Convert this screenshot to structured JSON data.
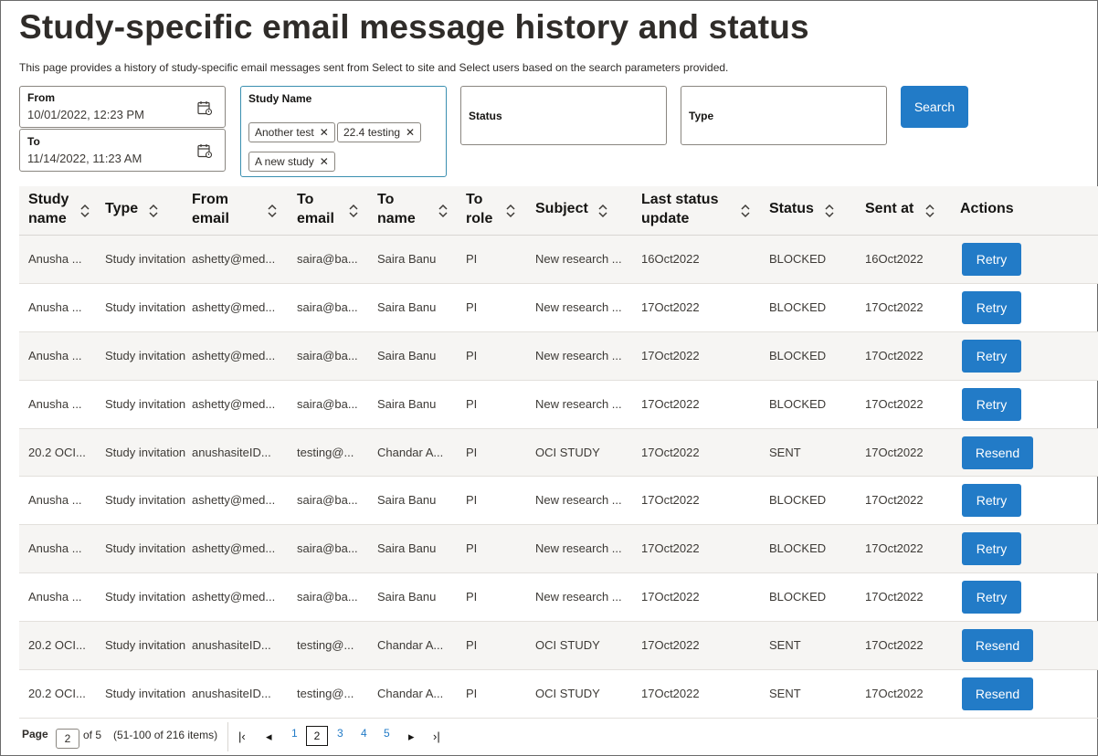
{
  "page": {
    "title": "Study-specific email message history and status",
    "description": "This page provides a history of study-specific email messages sent from Select to site and Select users based on the search parameters provided."
  },
  "filters": {
    "from": {
      "label": "From",
      "value": "10/01/2022, 12:23 PM"
    },
    "to": {
      "label": "To",
      "value": "11/14/2022, 11:23 AM"
    },
    "study_name": {
      "label": "Study Name",
      "chips": [
        "Another test",
        "22.4 testing",
        "A new study"
      ]
    },
    "status": {
      "label": "Status"
    },
    "type": {
      "label": "Type"
    },
    "search_label": "Search"
  },
  "table": {
    "columns": [
      {
        "l1": "Study",
        "l2": "name"
      },
      {
        "l1": "Type",
        "l2": ""
      },
      {
        "l1": "From",
        "l2": "email"
      },
      {
        "l1": "To",
        "l2": "email"
      },
      {
        "l1": "To",
        "l2": "name"
      },
      {
        "l1": "To",
        "l2": "role"
      },
      {
        "l1": "Subject",
        "l2": ""
      },
      {
        "l1": "Last status",
        "l2": "update"
      },
      {
        "l1": "Status",
        "l2": ""
      },
      {
        "l1": "Sent at",
        "l2": ""
      },
      {
        "l1": "Actions",
        "l2": ""
      }
    ],
    "rows": [
      {
        "study": "Anusha ...",
        "type": "Study invitation",
        "from": "ashetty@med...",
        "to_email": "saira@ba...",
        "to_name": "Saira Banu",
        "role": "PI",
        "subject": "New research ...",
        "last_update": "16Oct2022",
        "status": "BLOCKED",
        "sent_at": "16Oct2022",
        "action": "Retry"
      },
      {
        "study": "Anusha ...",
        "type": "Study invitation",
        "from": "ashetty@med...",
        "to_email": "saira@ba...",
        "to_name": "Saira Banu",
        "role": "PI",
        "subject": "New research ...",
        "last_update": "17Oct2022",
        "status": "BLOCKED",
        "sent_at": "17Oct2022",
        "action": "Retry"
      },
      {
        "study": "Anusha ...",
        "type": "Study invitation",
        "from": "ashetty@med...",
        "to_email": "saira@ba...",
        "to_name": "Saira Banu",
        "role": "PI",
        "subject": "New research ...",
        "last_update": "17Oct2022",
        "status": "BLOCKED",
        "sent_at": "17Oct2022",
        "action": "Retry"
      },
      {
        "study": "Anusha ...",
        "type": "Study invitation",
        "from": "ashetty@med...",
        "to_email": "saira@ba...",
        "to_name": "Saira Banu",
        "role": "PI",
        "subject": "New research ...",
        "last_update": "17Oct2022",
        "status": "BLOCKED",
        "sent_at": "17Oct2022",
        "action": "Retry"
      },
      {
        "study": "20.2 OCI...",
        "type": "Study invitation",
        "from": "anushasiteID...",
        "to_email": "testing@...",
        "to_name": "Chandar A...",
        "role": "PI",
        "subject": "OCI STUDY",
        "last_update": "17Oct2022",
        "status": "SENT",
        "sent_at": "17Oct2022",
        "action": "Resend"
      },
      {
        "study": "Anusha ...",
        "type": "Study invitation",
        "from": "ashetty@med...",
        "to_email": "saira@ba...",
        "to_name": "Saira Banu",
        "role": "PI",
        "subject": "New research ...",
        "last_update": "17Oct2022",
        "status": "BLOCKED",
        "sent_at": "17Oct2022",
        "action": "Retry"
      },
      {
        "study": "Anusha ...",
        "type": "Study invitation",
        "from": "ashetty@med...",
        "to_email": "saira@ba...",
        "to_name": "Saira Banu",
        "role": "PI",
        "subject": "New research ...",
        "last_update": "17Oct2022",
        "status": "BLOCKED",
        "sent_at": "17Oct2022",
        "action": "Retry"
      },
      {
        "study": "Anusha ...",
        "type": "Study invitation",
        "from": "ashetty@med...",
        "to_email": "saira@ba...",
        "to_name": "Saira Banu",
        "role": "PI",
        "subject": "New research ...",
        "last_update": "17Oct2022",
        "status": "BLOCKED",
        "sent_at": "17Oct2022",
        "action": "Retry"
      },
      {
        "study": "20.2 OCI...",
        "type": "Study invitation",
        "from": "anushasiteID...",
        "to_email": "testing@...",
        "to_name": "Chandar A...",
        "role": "PI",
        "subject": "OCI STUDY",
        "last_update": "17Oct2022",
        "status": "SENT",
        "sent_at": "17Oct2022",
        "action": "Resend"
      },
      {
        "study": "20.2 OCI...",
        "type": "Study invitation",
        "from": "anushasiteID...",
        "to_email": "testing@...",
        "to_name": "Chandar A...",
        "role": "PI",
        "subject": "OCI STUDY",
        "last_update": "17Oct2022",
        "status": "SENT",
        "sent_at": "17Oct2022",
        "action": "Resend"
      }
    ]
  },
  "pagination": {
    "label": "Page",
    "current": "2",
    "of_text": "of 5",
    "range_text": "(51-100 of 216 items)",
    "pages": [
      "1",
      "2",
      "3",
      "4",
      "5"
    ]
  },
  "icons": {
    "calendar": "calendar-icon",
    "sort": "sort-icon",
    "chip_remove": "close-icon",
    "first": "first-page-icon",
    "prev": "previous-page-icon",
    "next": "next-page-icon",
    "last": "last-page-icon"
  },
  "colors": {
    "accent": "#227bc7",
    "stripe": "#f6f5f3"
  }
}
